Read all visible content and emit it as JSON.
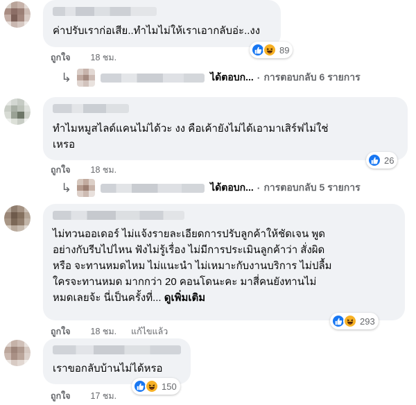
{
  "comments": [
    {
      "text": "ค่าปรับเราก่อเสีย..ทำไมไม่ให้เราเอากลับอ่ะ..งง",
      "like_label": "ถูกใจ",
      "time": "18 ชม.",
      "reactions": [
        "like-icon",
        "haha-icon"
      ],
      "reaction_count": "89",
      "reply": {
        "preview": "ได้ตอบก...",
        "separator": "·",
        "summary": "การตอบกลับ 6 รายการ"
      }
    },
    {
      "text_lines": [
        "ทำไมหมูสไลด์แคนไม่ได้วะ งง คือเค้ายังไม่ได้เอามาเสิร์ฟไม่ใช่",
        "เหรอ"
      ],
      "like_label": "ถูกใจ",
      "time": "18 ชม.",
      "reactions": [
        "like-icon"
      ],
      "reaction_count": "26",
      "reply": {
        "preview": "ได้ตอบก...",
        "separator": "·",
        "summary": "การตอบกลับ 5 รายการ"
      }
    },
    {
      "text_lines": [
        "ไม่ทวนออเดอร์ ไม่แจ้งรายละเอียดการปรับลูกค้าให้ชัดเจน พูด",
        "อย่างกับรีบไปไหน ฟังไม่รู้เรื่อง ไม่มีการประเมินลูกค้าว่า สั่งผิด",
        "หรือ จะทานหมดไหม ไม่แนะนำ ไม่เหมาะกับงานบริการ ไม่ปลื้ม",
        "ใครจะทานหมด มากกว่า 20 คอนโดนะคะ มาสี่คนยังทานไม่",
        "หมดเลยจ้ะ นี่เป็นครั้งที่..."
      ],
      "see_more": "ดูเพิ่มเติม",
      "like_label": "ถูกใจ",
      "time": "18 ชม.",
      "edited": "แก้ไขแล้ว",
      "reactions": [
        "like-icon",
        "haha-icon"
      ],
      "reaction_count": "293"
    },
    {
      "text": "เราขอกลับบ้านไม่ได้หรอ",
      "like_label": "ถูกใจ",
      "time": "17 ชม.",
      "reactions": [
        "like-icon",
        "haha-icon"
      ],
      "reaction_count": "150"
    }
  ],
  "colors": {
    "bubble": "#f0f2f5",
    "like_blue": "#1877f2",
    "haha_yellow": "#f7b125",
    "meta_gray": "#65676b"
  }
}
